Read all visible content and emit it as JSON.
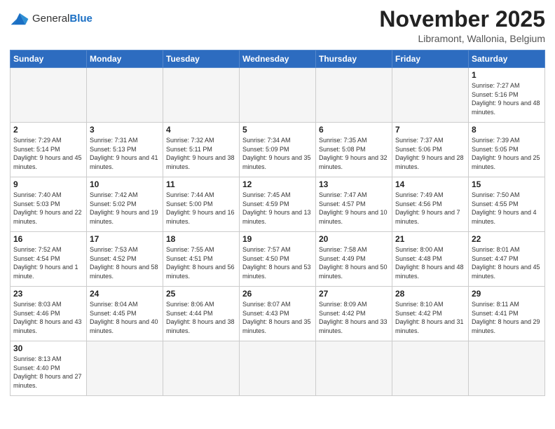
{
  "logo": {
    "text_general": "General",
    "text_blue": "Blue"
  },
  "title": "November 2025",
  "subtitle": "Libramont, Wallonia, Belgium",
  "days_of_week": [
    "Sunday",
    "Monday",
    "Tuesday",
    "Wednesday",
    "Thursday",
    "Friday",
    "Saturday"
  ],
  "weeks": [
    [
      {
        "day": "",
        "empty": true
      },
      {
        "day": "",
        "empty": true
      },
      {
        "day": "",
        "empty": true
      },
      {
        "day": "",
        "empty": true
      },
      {
        "day": "",
        "empty": true
      },
      {
        "day": "",
        "empty": true
      },
      {
        "day": "1",
        "sunrise": "7:27 AM",
        "sunset": "5:16 PM",
        "daylight": "9 hours and 48 minutes."
      }
    ],
    [
      {
        "day": "2",
        "sunrise": "7:29 AM",
        "sunset": "5:14 PM",
        "daylight": "9 hours and 45 minutes."
      },
      {
        "day": "3",
        "sunrise": "7:31 AM",
        "sunset": "5:13 PM",
        "daylight": "9 hours and 41 minutes."
      },
      {
        "day": "4",
        "sunrise": "7:32 AM",
        "sunset": "5:11 PM",
        "daylight": "9 hours and 38 minutes."
      },
      {
        "day": "5",
        "sunrise": "7:34 AM",
        "sunset": "5:09 PM",
        "daylight": "9 hours and 35 minutes."
      },
      {
        "day": "6",
        "sunrise": "7:35 AM",
        "sunset": "5:08 PM",
        "daylight": "9 hours and 32 minutes."
      },
      {
        "day": "7",
        "sunrise": "7:37 AM",
        "sunset": "5:06 PM",
        "daylight": "9 hours and 28 minutes."
      },
      {
        "day": "8",
        "sunrise": "7:39 AM",
        "sunset": "5:05 PM",
        "daylight": "9 hours and 25 minutes."
      }
    ],
    [
      {
        "day": "9",
        "sunrise": "7:40 AM",
        "sunset": "5:03 PM",
        "daylight": "9 hours and 22 minutes."
      },
      {
        "day": "10",
        "sunrise": "7:42 AM",
        "sunset": "5:02 PM",
        "daylight": "9 hours and 19 minutes."
      },
      {
        "day": "11",
        "sunrise": "7:44 AM",
        "sunset": "5:00 PM",
        "daylight": "9 hours and 16 minutes."
      },
      {
        "day": "12",
        "sunrise": "7:45 AM",
        "sunset": "4:59 PM",
        "daylight": "9 hours and 13 minutes."
      },
      {
        "day": "13",
        "sunrise": "7:47 AM",
        "sunset": "4:57 PM",
        "daylight": "9 hours and 10 minutes."
      },
      {
        "day": "14",
        "sunrise": "7:49 AM",
        "sunset": "4:56 PM",
        "daylight": "9 hours and 7 minutes."
      },
      {
        "day": "15",
        "sunrise": "7:50 AM",
        "sunset": "4:55 PM",
        "daylight": "9 hours and 4 minutes."
      }
    ],
    [
      {
        "day": "16",
        "sunrise": "7:52 AM",
        "sunset": "4:54 PM",
        "daylight": "9 hours and 1 minute."
      },
      {
        "day": "17",
        "sunrise": "7:53 AM",
        "sunset": "4:52 PM",
        "daylight": "8 hours and 58 minutes."
      },
      {
        "day": "18",
        "sunrise": "7:55 AM",
        "sunset": "4:51 PM",
        "daylight": "8 hours and 56 minutes."
      },
      {
        "day": "19",
        "sunrise": "7:57 AM",
        "sunset": "4:50 PM",
        "daylight": "8 hours and 53 minutes."
      },
      {
        "day": "20",
        "sunrise": "7:58 AM",
        "sunset": "4:49 PM",
        "daylight": "8 hours and 50 minutes."
      },
      {
        "day": "21",
        "sunrise": "8:00 AM",
        "sunset": "4:48 PM",
        "daylight": "8 hours and 48 minutes."
      },
      {
        "day": "22",
        "sunrise": "8:01 AM",
        "sunset": "4:47 PM",
        "daylight": "8 hours and 45 minutes."
      }
    ],
    [
      {
        "day": "23",
        "sunrise": "8:03 AM",
        "sunset": "4:46 PM",
        "daylight": "8 hours and 43 minutes."
      },
      {
        "day": "24",
        "sunrise": "8:04 AM",
        "sunset": "4:45 PM",
        "daylight": "8 hours and 40 minutes."
      },
      {
        "day": "25",
        "sunrise": "8:06 AM",
        "sunset": "4:44 PM",
        "daylight": "8 hours and 38 minutes."
      },
      {
        "day": "26",
        "sunrise": "8:07 AM",
        "sunset": "4:43 PM",
        "daylight": "8 hours and 35 minutes."
      },
      {
        "day": "27",
        "sunrise": "8:09 AM",
        "sunset": "4:42 PM",
        "daylight": "8 hours and 33 minutes."
      },
      {
        "day": "28",
        "sunrise": "8:10 AM",
        "sunset": "4:42 PM",
        "daylight": "8 hours and 31 minutes."
      },
      {
        "day": "29",
        "sunrise": "8:11 AM",
        "sunset": "4:41 PM",
        "daylight": "8 hours and 29 minutes."
      }
    ],
    [
      {
        "day": "30",
        "sunrise": "8:13 AM",
        "sunset": "4:40 PM",
        "daylight": "8 hours and 27 minutes."
      },
      {
        "day": "",
        "empty": true
      },
      {
        "day": "",
        "empty": true
      },
      {
        "day": "",
        "empty": true
      },
      {
        "day": "",
        "empty": true
      },
      {
        "day": "",
        "empty": true
      },
      {
        "day": "",
        "empty": true
      }
    ]
  ]
}
